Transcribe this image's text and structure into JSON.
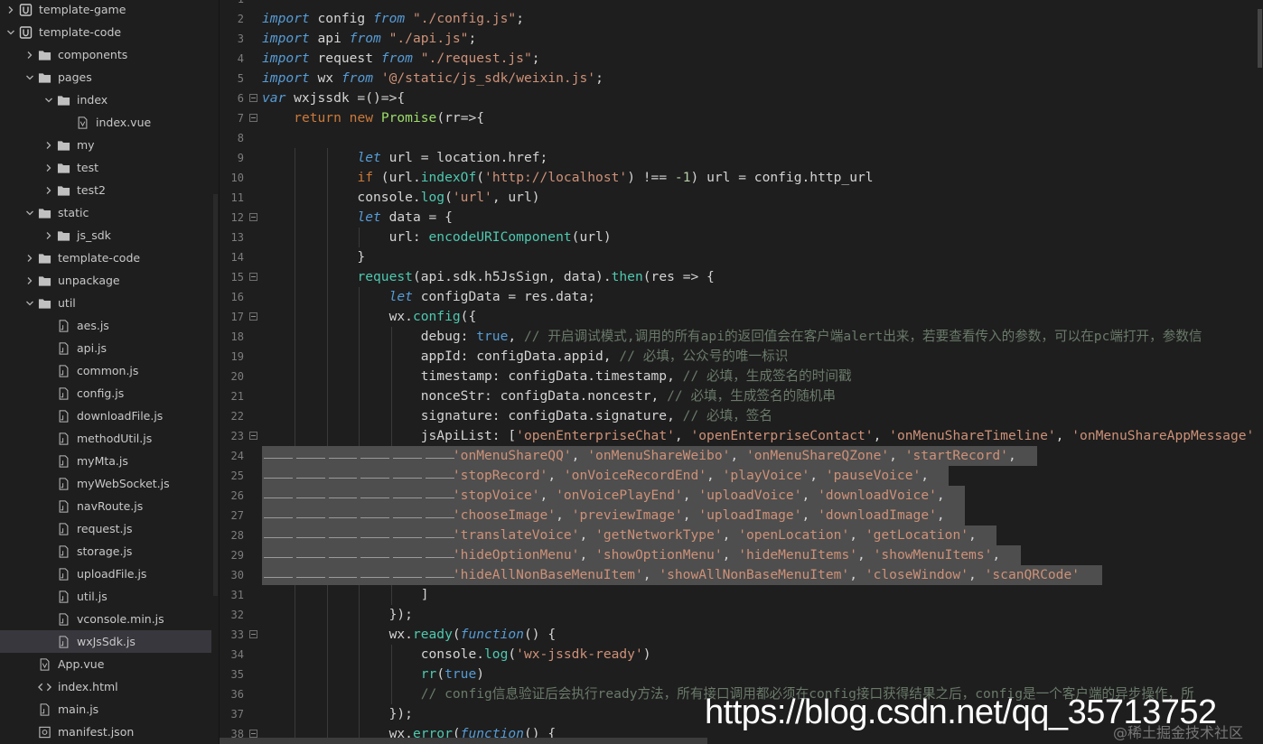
{
  "sidebar": {
    "items": [
      {
        "label": "template-game",
        "icon": "project-icon",
        "expanded": false
      },
      {
        "label": "template-code",
        "icon": "project-icon",
        "expanded": true
      },
      {
        "label": "components",
        "icon": "folder-icon",
        "expanded": false
      },
      {
        "label": "pages",
        "icon": "folder-icon",
        "expanded": true
      },
      {
        "label": "index",
        "icon": "folder-icon",
        "expanded": true
      },
      {
        "label": "index.vue",
        "icon": "vue-file-icon"
      },
      {
        "label": "my",
        "icon": "folder-icon",
        "expanded": false
      },
      {
        "label": "test",
        "icon": "folder-icon",
        "expanded": false
      },
      {
        "label": "test2",
        "icon": "folder-icon",
        "expanded": false
      },
      {
        "label": "static",
        "icon": "folder-icon",
        "expanded": true
      },
      {
        "label": "js_sdk",
        "icon": "folder-icon",
        "expanded": false
      },
      {
        "label": "template-code",
        "icon": "folder-icon",
        "expanded": false
      },
      {
        "label": "unpackage",
        "icon": "folder-icon",
        "expanded": false
      },
      {
        "label": "util",
        "icon": "folder-icon",
        "expanded": true
      },
      {
        "label": "aes.js",
        "icon": "js-file-icon"
      },
      {
        "label": "api.js",
        "icon": "js-file-icon"
      },
      {
        "label": "common.js",
        "icon": "js-file-icon"
      },
      {
        "label": "config.js",
        "icon": "js-file-icon"
      },
      {
        "label": "downloadFile.js",
        "icon": "js-file-icon"
      },
      {
        "label": "methodUtil.js",
        "icon": "js-file-icon"
      },
      {
        "label": "myMta.js",
        "icon": "js-file-icon"
      },
      {
        "label": "myWebSocket.js",
        "icon": "js-file-icon"
      },
      {
        "label": "navRoute.js",
        "icon": "js-file-icon"
      },
      {
        "label": "request.js",
        "icon": "js-file-icon"
      },
      {
        "label": "storage.js",
        "icon": "js-file-icon"
      },
      {
        "label": "uploadFile.js",
        "icon": "js-file-icon"
      },
      {
        "label": "util.js",
        "icon": "js-file-icon"
      },
      {
        "label": "vconsole.min.js",
        "icon": "js-file-icon"
      },
      {
        "label": "wxJsSdk.js",
        "icon": "js-file-icon",
        "selected": true
      },
      {
        "label": "App.vue",
        "icon": "vue-file-icon"
      },
      {
        "label": "index.html",
        "icon": "html-file-icon"
      },
      {
        "label": "main.js",
        "icon": "js-file-icon"
      },
      {
        "label": "manifest.json",
        "icon": "json-file-icon"
      }
    ]
  },
  "editor": {
    "lines": [
      {
        "n": "1",
        "fold": false,
        "tokens": []
      },
      {
        "n": "2",
        "fold": false,
        "tokens": [
          [
            "kw",
            "import"
          ],
          [
            "plain",
            " config "
          ],
          [
            "kw",
            "from"
          ],
          [
            "plain",
            " "
          ],
          [
            "str",
            "\"./config.js\""
          ],
          [
            "plain",
            ";"
          ]
        ]
      },
      {
        "n": "3",
        "fold": false,
        "tokens": [
          [
            "kw",
            "import"
          ],
          [
            "plain",
            " api "
          ],
          [
            "kw",
            "from"
          ],
          [
            "plain",
            " "
          ],
          [
            "str",
            "\"./api.js\""
          ],
          [
            "plain",
            ";"
          ]
        ]
      },
      {
        "n": "4",
        "fold": false,
        "tokens": [
          [
            "kw",
            "import"
          ],
          [
            "plain",
            " request "
          ],
          [
            "kw",
            "from"
          ],
          [
            "plain",
            " "
          ],
          [
            "str",
            "\"./request.js\""
          ],
          [
            "plain",
            ";"
          ]
        ]
      },
      {
        "n": "5",
        "fold": false,
        "tokens": [
          [
            "kw",
            "import"
          ],
          [
            "plain",
            " wx "
          ],
          [
            "kw",
            "from"
          ],
          [
            "plain",
            " "
          ],
          [
            "str",
            "'@/static/js_sdk/weixin.js'"
          ],
          [
            "plain",
            ";"
          ]
        ]
      },
      {
        "n": "6",
        "fold": true,
        "tokens": [
          [
            "kw",
            "var"
          ],
          [
            "plain",
            " wxjssdk =()=>{"
          ]
        ]
      },
      {
        "n": "7",
        "fold": true,
        "tokens": [
          [
            "plain",
            "    "
          ],
          [
            "kw2",
            "return"
          ],
          [
            "plain",
            " "
          ],
          [
            "kw2",
            "new"
          ],
          [
            "plain",
            " "
          ],
          [
            "cls",
            "Promise"
          ],
          [
            "plain",
            "(rr=>{"
          ]
        ]
      },
      {
        "n": "8",
        "fold": false,
        "tokens": []
      },
      {
        "n": "9",
        "fold": false,
        "tokens": [
          [
            "plain",
            "            "
          ],
          [
            "kw",
            "let"
          ],
          [
            "plain",
            " url = location.href;"
          ]
        ]
      },
      {
        "n": "10",
        "fold": false,
        "tokens": [
          [
            "plain",
            "            "
          ],
          [
            "kw2",
            "if"
          ],
          [
            "plain",
            " (url."
          ],
          [
            "fn",
            "indexOf"
          ],
          [
            "plain",
            "("
          ],
          [
            "str",
            "'http://localhost'"
          ],
          [
            "plain",
            ") !== "
          ],
          [
            "num",
            "-1"
          ],
          [
            "plain",
            ") url = config.http_url"
          ]
        ]
      },
      {
        "n": "11",
        "fold": false,
        "tokens": [
          [
            "plain",
            "            console."
          ],
          [
            "fn",
            "log"
          ],
          [
            "plain",
            "("
          ],
          [
            "str",
            "'url'"
          ],
          [
            "plain",
            ", url)"
          ]
        ]
      },
      {
        "n": "12",
        "fold": true,
        "tokens": [
          [
            "plain",
            "            "
          ],
          [
            "kw",
            "let"
          ],
          [
            "plain",
            " data = {"
          ]
        ]
      },
      {
        "n": "13",
        "fold": false,
        "tokens": [
          [
            "plain",
            "                url: "
          ],
          [
            "fn",
            "encodeURIComponent"
          ],
          [
            "plain",
            "(url)"
          ]
        ]
      },
      {
        "n": "14",
        "fold": false,
        "tokens": [
          [
            "plain",
            "            }"
          ]
        ]
      },
      {
        "n": "15",
        "fold": true,
        "tokens": [
          [
            "plain",
            "            "
          ],
          [
            "fn",
            "request"
          ],
          [
            "plain",
            "(api.sdk.h5JsSign, data)."
          ],
          [
            "fn",
            "then"
          ],
          [
            "plain",
            "(res => {"
          ]
        ]
      },
      {
        "n": "16",
        "fold": false,
        "tokens": [
          [
            "plain",
            "                "
          ],
          [
            "kw",
            "let"
          ],
          [
            "plain",
            " configData = res.data;"
          ]
        ]
      },
      {
        "n": "17",
        "fold": true,
        "tokens": [
          [
            "plain",
            "                wx."
          ],
          [
            "fn",
            "config"
          ],
          [
            "plain",
            "({"
          ]
        ]
      },
      {
        "n": "18",
        "fold": false,
        "tokens": [
          [
            "plain",
            "                    debug: "
          ],
          [
            "bool",
            "true"
          ],
          [
            "plain",
            ", "
          ],
          [
            "cmt",
            "// 开启调试模式,调用的所有api的返回值会在客户端alert出来，若要查看传入的参数，可以在pc端打开，参数信"
          ]
        ]
      },
      {
        "n": "19",
        "fold": false,
        "tokens": [
          [
            "plain",
            "                    appId: configData.appid, "
          ],
          [
            "cmt",
            "// 必填，公众号的唯一标识"
          ]
        ]
      },
      {
        "n": "20",
        "fold": false,
        "tokens": [
          [
            "plain",
            "                    timestamp: configData.timestamp, "
          ],
          [
            "cmt",
            "// 必填，生成签名的时间戳"
          ]
        ]
      },
      {
        "n": "21",
        "fold": false,
        "tokens": [
          [
            "plain",
            "                    nonceStr: configData.noncestr, "
          ],
          [
            "cmt",
            "// 必填，生成签名的随机串"
          ]
        ]
      },
      {
        "n": "22",
        "fold": false,
        "tokens": [
          [
            "plain",
            "                    signature: configData.signature, "
          ],
          [
            "cmt",
            "// 必填，签名"
          ]
        ]
      },
      {
        "n": "23",
        "fold": true,
        "tokens": [
          [
            "plain",
            "                    jsApiList: ["
          ],
          [
            "str",
            "'openEnterpriseChat'"
          ],
          [
            "plain",
            ", "
          ],
          [
            "str",
            "'openEnterpriseContact'"
          ],
          [
            "plain",
            ", "
          ],
          [
            "str",
            "'onMenuShareTimeline'"
          ],
          [
            "plain",
            ", "
          ],
          [
            "str",
            "'onMenuShareAppMessage'"
          ]
        ]
      },
      {
        "n": "24",
        "fold": false,
        "sel": true,
        "tokens": [
          [
            "plain",
            "                        "
          ],
          [
            "str",
            "'onMenuShareQQ'"
          ],
          [
            "plain",
            ", "
          ],
          [
            "str",
            "'onMenuShareWeibo'"
          ],
          [
            "plain",
            ", "
          ],
          [
            "str",
            "'onMenuShareQZone'"
          ],
          [
            "plain",
            ", "
          ],
          [
            "str",
            "'startRecord'"
          ],
          [
            "plain",
            ","
          ]
        ]
      },
      {
        "n": "25",
        "fold": false,
        "sel": true,
        "tokens": [
          [
            "plain",
            "                        "
          ],
          [
            "str",
            "'stopRecord'"
          ],
          [
            "plain",
            ", "
          ],
          [
            "str",
            "'onVoiceRecordEnd'"
          ],
          [
            "plain",
            ", "
          ],
          [
            "str",
            "'playVoice'"
          ],
          [
            "plain",
            ", "
          ],
          [
            "str",
            "'pauseVoice'"
          ],
          [
            "plain",
            ","
          ]
        ]
      },
      {
        "n": "26",
        "fold": false,
        "sel": true,
        "tokens": [
          [
            "plain",
            "                        "
          ],
          [
            "str",
            "'stopVoice'"
          ],
          [
            "plain",
            ", "
          ],
          [
            "str",
            "'onVoicePlayEnd'"
          ],
          [
            "plain",
            ", "
          ],
          [
            "str",
            "'uploadVoice'"
          ],
          [
            "plain",
            ", "
          ],
          [
            "str",
            "'downloadVoice'"
          ],
          [
            "plain",
            ","
          ]
        ]
      },
      {
        "n": "27",
        "fold": false,
        "sel": true,
        "tokens": [
          [
            "plain",
            "                        "
          ],
          [
            "str",
            "'chooseImage'"
          ],
          [
            "plain",
            ", "
          ],
          [
            "str",
            "'previewImage'"
          ],
          [
            "plain",
            ", "
          ],
          [
            "str",
            "'uploadImage'"
          ],
          [
            "plain",
            ", "
          ],
          [
            "str",
            "'downloadImage'"
          ],
          [
            "plain",
            ","
          ]
        ]
      },
      {
        "n": "28",
        "fold": false,
        "sel": true,
        "tokens": [
          [
            "plain",
            "                        "
          ],
          [
            "str",
            "'translateVoice'"
          ],
          [
            "plain",
            ", "
          ],
          [
            "str",
            "'getNetworkType'"
          ],
          [
            "plain",
            ", "
          ],
          [
            "str",
            "'openLocation'"
          ],
          [
            "plain",
            ", "
          ],
          [
            "str",
            "'getLocation'"
          ],
          [
            "plain",
            ","
          ]
        ]
      },
      {
        "n": "29",
        "fold": false,
        "sel": true,
        "tokens": [
          [
            "plain",
            "                        "
          ],
          [
            "str",
            "'hideOptionMenu'"
          ],
          [
            "plain",
            ", "
          ],
          [
            "str",
            "'showOptionMenu'"
          ],
          [
            "plain",
            ", "
          ],
          [
            "str",
            "'hideMenuItems'"
          ],
          [
            "plain",
            ", "
          ],
          [
            "str",
            "'showMenuItems'"
          ],
          [
            "plain",
            ","
          ]
        ]
      },
      {
        "n": "30",
        "fold": false,
        "sel": true,
        "tokens": [
          [
            "plain",
            "                        "
          ],
          [
            "str",
            "'hideAllNonBaseMenuItem'"
          ],
          [
            "plain",
            ", "
          ],
          [
            "str",
            "'showAllNonBaseMenuItem'"
          ],
          [
            "plain",
            ", "
          ],
          [
            "str",
            "'closeWindow'"
          ],
          [
            "plain",
            ", "
          ],
          [
            "str",
            "'scanQRCode'"
          ]
        ]
      },
      {
        "n": "31",
        "fold": false,
        "tokens": [
          [
            "plain",
            "                    ]"
          ]
        ]
      },
      {
        "n": "32",
        "fold": false,
        "tokens": [
          [
            "plain",
            "                });"
          ]
        ]
      },
      {
        "n": "33",
        "fold": true,
        "tokens": [
          [
            "plain",
            "                wx."
          ],
          [
            "fn",
            "ready"
          ],
          [
            "plain",
            "("
          ],
          [
            "kw",
            "function"
          ],
          [
            "plain",
            "() {"
          ]
        ]
      },
      {
        "n": "34",
        "fold": false,
        "tokens": [
          [
            "plain",
            "                    console."
          ],
          [
            "fn",
            "log"
          ],
          [
            "plain",
            "("
          ],
          [
            "str",
            "'wx-jssdk-ready'"
          ],
          [
            "plain",
            ")"
          ]
        ]
      },
      {
        "n": "35",
        "fold": false,
        "tokens": [
          [
            "plain",
            "                    "
          ],
          [
            "fn",
            "rr"
          ],
          [
            "plain",
            "("
          ],
          [
            "bool",
            "true"
          ],
          [
            "plain",
            ")"
          ]
        ]
      },
      {
        "n": "36",
        "fold": false,
        "tokens": [
          [
            "plain",
            "                    "
          ],
          [
            "cmt",
            "// config信息验证后会执行ready方法，所有接口调用都必须在config接口获得结果之后，config是一个客户端的异步操作，所"
          ]
        ]
      },
      {
        "n": "37",
        "fold": false,
        "tokens": [
          [
            "plain",
            "                });"
          ]
        ]
      },
      {
        "n": "38",
        "fold": true,
        "tokens": [
          [
            "plain",
            "                wx."
          ],
          [
            "fn",
            "error"
          ],
          [
            "plain",
            "("
          ],
          [
            "kw",
            "function"
          ],
          [
            "plain",
            "() {"
          ]
        ]
      }
    ]
  },
  "watermark": {
    "main": "https://blog.csdn.net/qq_35713752",
    "sub": "@稀土掘金技术社区"
  },
  "colors": {
    "background": "#1e1e1e",
    "keyword": "#569cd6",
    "string": "#ce9178",
    "function": "#4ec9b0",
    "comment": "#6a7a6a",
    "selection": "#4e4e4e"
  }
}
